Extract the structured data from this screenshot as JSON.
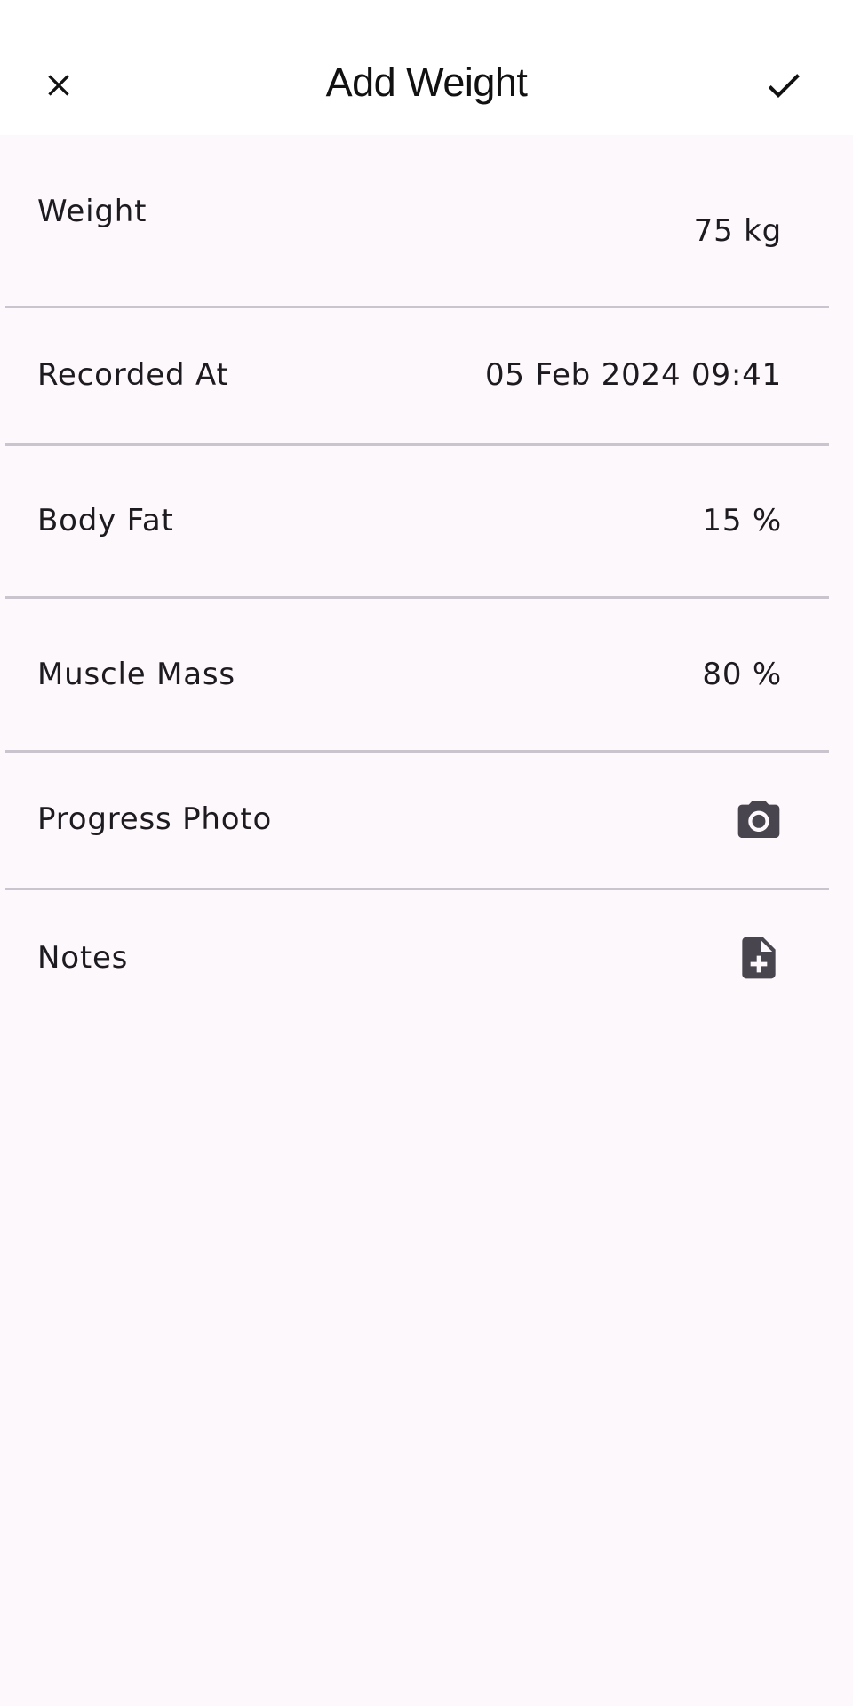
{
  "app_bar": {
    "title": "Add Weight",
    "close_icon": "close-icon",
    "confirm_icon": "check-icon"
  },
  "fields": [
    {
      "label": "Weight",
      "value": "75 kg"
    },
    {
      "label": "Recorded At",
      "value": "05 Feb 2024 09:41"
    },
    {
      "label": "Body Fat",
      "value": "15 %"
    },
    {
      "label": "Muscle Mass",
      "value": "80 %"
    },
    {
      "label": "Progress Photo",
      "icon": "camera-icon"
    },
    {
      "label": "Notes",
      "icon": "note-add-icon"
    }
  ],
  "colors": {
    "background": "#fdf8fc",
    "app_bar": "#ffffff",
    "divider": "#cac4cf",
    "icon": "#49454f",
    "text": "#1d1b20"
  }
}
